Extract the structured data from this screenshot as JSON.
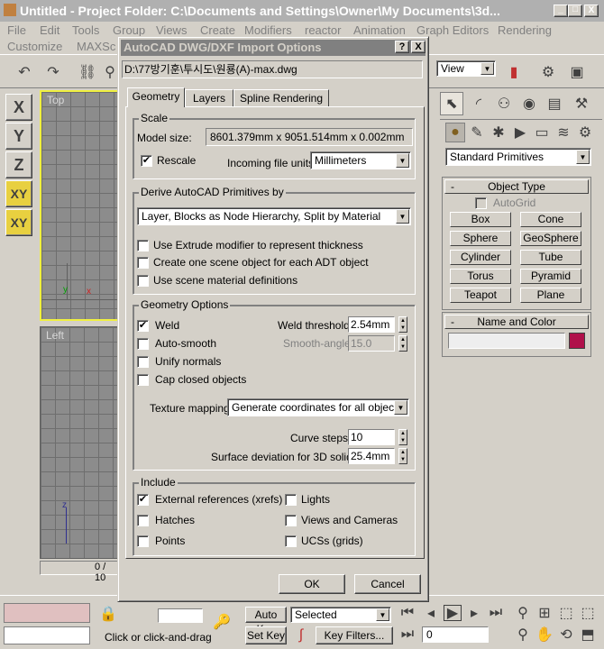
{
  "app": {
    "title": "Untitled    - Project Folder: C:\\Documents and Settings\\Owner\\My Documents\\3d...",
    "menu": [
      "File",
      "Edit",
      "Tools",
      "Group",
      "Views",
      "Create",
      "Modifiers",
      "reactor",
      "Animation",
      "Graph Editors",
      "Rendering"
    ],
    "menu2": [
      "Customize",
      "MAXSc"
    ],
    "view_dropdown": "View",
    "axis_buttons": [
      "X",
      "Y",
      "Z",
      "XY",
      "XY"
    ],
    "viewport_top_label": "Top",
    "viewport_left_label": "Left",
    "timeline": "0 / 10"
  },
  "right_panel": {
    "category_dropdown": "Standard Primitives",
    "object_type_header": "Object Type",
    "autogrid_label": "AutoGrid",
    "primitives": [
      "Box",
      "Cone",
      "Sphere",
      "GeoSphere",
      "Cylinder",
      "Tube",
      "Torus",
      "Pyramid",
      "Teapot",
      "Plane"
    ],
    "name_color_header": "Name and Color",
    "name_value": "",
    "color": "#b0104a"
  },
  "bottom": {
    "auto_key": "Auto Key",
    "set_key": "Set Key",
    "selected_dropdown": "Selected",
    "key_filters": "Key Filters...",
    "status": "Click or click-and-drag",
    "frame_value": "0"
  },
  "dialog": {
    "title": "AutoCAD DWG/DXF Import Options",
    "help_btn": "?",
    "close_btn": "X",
    "file_path": "D:\\77방기훈\\투시도\\원룡(A)-max.dwg",
    "tabs": [
      "Geometry",
      "Layers",
      "Spline Rendering"
    ],
    "scale": {
      "label": "Scale",
      "model_size_label": "Model size:",
      "model_size_value": "8601.379mm x 9051.514mm x 0.002mm",
      "rescale_label": "Rescale",
      "rescale_checked": true,
      "units_label": "Incoming file units:",
      "units_value": "Millimeters"
    },
    "derive": {
      "label": "Derive AutoCAD Primitives by",
      "value": "Layer, Blocks as Node Hierarchy, Split by Material",
      "options": [
        {
          "label": "Use Extrude modifier to represent thickness",
          "checked": false
        },
        {
          "label": "Create one scene object for each ADT object",
          "checked": false
        },
        {
          "label": "Use scene material definitions",
          "checked": false
        }
      ]
    },
    "geometry": {
      "label": "Geometry Options",
      "weld_label": "Weld",
      "weld_checked": true,
      "weld_threshold_label": "Weld threshold:",
      "weld_threshold_value": "2.54mm",
      "auto_smooth_label": "Auto-smooth",
      "smooth_angle_label": "Smooth-angle:",
      "smooth_angle_value": "15.0",
      "unify_normals_label": "Unify normals",
      "cap_closed_label": "Cap closed objects",
      "texture_label": "Texture mapping:",
      "texture_value": "Generate coordinates for all objects",
      "curve_steps_label": "Curve steps:",
      "curve_steps_value": "10",
      "surface_dev_label": "Surface deviation for 3D solids:",
      "surface_dev_value": "25.4mm"
    },
    "include": {
      "label": "Include",
      "items": [
        {
          "label": "External references (xrefs)",
          "checked": true
        },
        {
          "label": "Lights",
          "checked": false
        },
        {
          "label": "Hatches",
          "checked": false
        },
        {
          "label": "Views and Cameras",
          "checked": false
        },
        {
          "label": "Points",
          "checked": false
        },
        {
          "label": "UCSs (grids)",
          "checked": false
        }
      ]
    },
    "ok": "OK",
    "cancel": "Cancel"
  }
}
